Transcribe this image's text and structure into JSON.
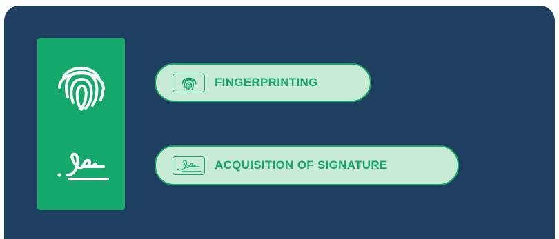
{
  "rail": {
    "icons": [
      "fingerprint-icon",
      "signature-icon"
    ]
  },
  "items": [
    {
      "label": "FINGERPRINTING",
      "icon": "fingerprint-icon"
    },
    {
      "label": "ACQUISITION OF SIGNATURE",
      "icon": "signature-icon"
    }
  ],
  "colors": {
    "panel": "#1e3f60",
    "rail": "#15aa6b",
    "pill_bg": "#c8ebd6",
    "accent": "#17a868",
    "icon_white": "#ffffff"
  }
}
